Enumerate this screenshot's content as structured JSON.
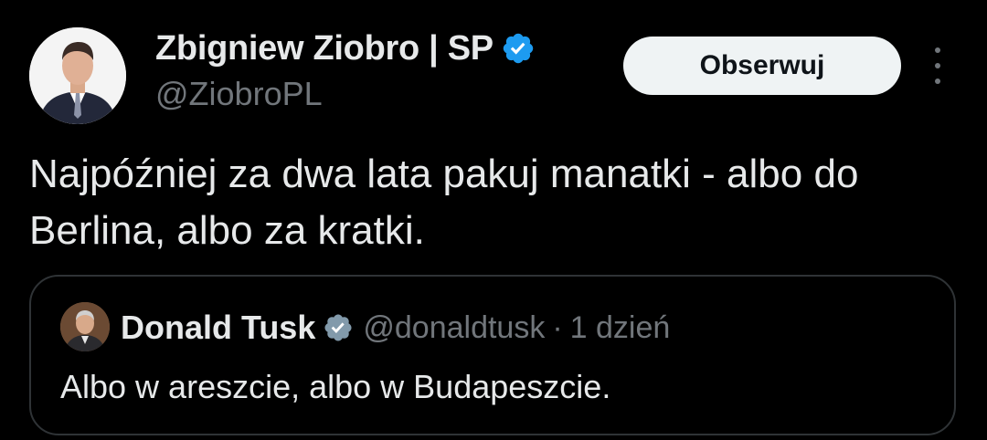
{
  "tweet": {
    "author": {
      "display_name": "Zbigniew Ziobro | SP",
      "handle": "@ZiobroPL",
      "verified": true,
      "avatar_icon": "person-in-suit-avatar"
    },
    "follow_label": "Obserwuj",
    "more_icon": "more-vertical-icon",
    "text": "Najpóźniej za dwa lata pakuj manatki - albo do Berlina, albo za kratki.",
    "quote": {
      "author": {
        "display_name": "Donald Tusk",
        "handle": "@donaldtusk",
        "verified": true,
        "avatar_icon": "person-avatar"
      },
      "separator": "·",
      "time": "1 dzień",
      "text": "Albo w areszcie, albo w Budapeszcie."
    }
  },
  "colors": {
    "background": "#000000",
    "text_primary": "#e7e9ea",
    "text_secondary": "#71767b",
    "verified_badge": "#1d9bf0",
    "verified_badge_quote": "#829aab",
    "follow_button_bg": "#eff3f4",
    "follow_button_text": "#0f1419",
    "quote_border": "#2f3336"
  }
}
